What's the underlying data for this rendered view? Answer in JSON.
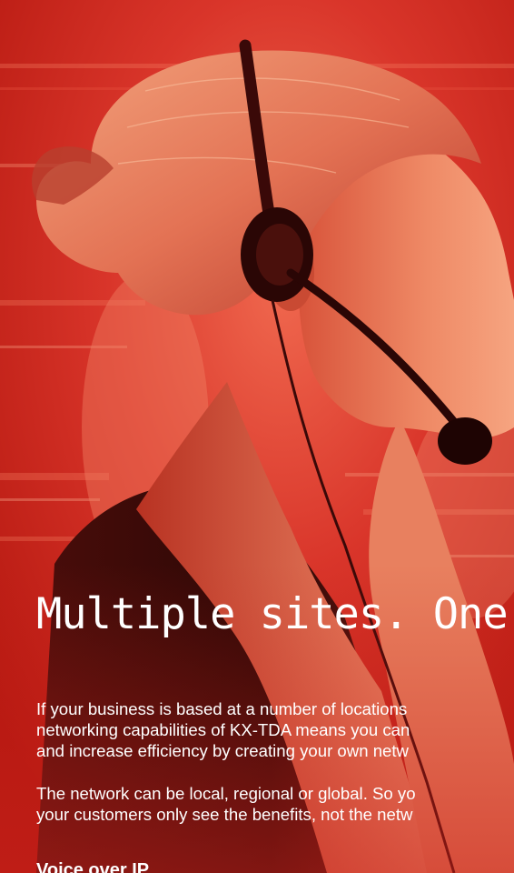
{
  "page": {
    "headline": "Multiple sites. One s",
    "paragraph_1": [
      "If your business is based at a number of locations",
      "networking capabilities of KX-TDA means you can",
      "and increase efficiency by creating your own netw"
    ],
    "paragraph_2": [
      "The network can be local, regional or global. So yo",
      "your customers only see the benefits, not the netw"
    ],
    "subheading": "Voice over IP"
  },
  "colors": {
    "background_red": "#c8221c",
    "text": "#ffffff"
  }
}
